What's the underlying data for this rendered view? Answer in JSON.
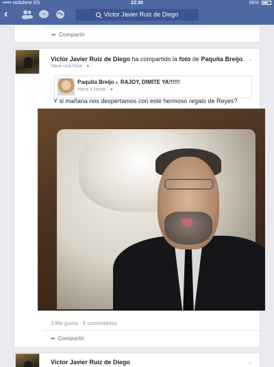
{
  "status_bar": {
    "carrier": "••••• vodafone ES",
    "time": "22:30",
    "battery": "66%",
    "battery_level": 0.66
  },
  "nav": {
    "search_text": "Victor Javier Ruiz de Diego"
  },
  "top_card": {
    "share_label": "Compartir"
  },
  "post": {
    "author": "Victor Javier Ruiz de Diego",
    "action": " ha compartido la ",
    "object": "foto",
    "prep": " de ",
    "target": "Paquita Breijo",
    "end": ".",
    "time": "Hace una hora",
    "privacy_sep": "·",
    "shared": {
      "author": "Paquita Breijo",
      "arrow": "▶",
      "group": "RAJOY, DIMITE YA!!!!!!",
      "time": "Hace 4 horas",
      "privacy_sep": "·"
    },
    "caption": "Y si mañana nos despertamos con este hermoso regalo de Reyes?",
    "likes": "3 Me gusta",
    "dot": "·",
    "comments": "8 comentarios",
    "share_label": "Compartir"
  },
  "next_post": {
    "author": "Victor Javier Ruiz de Diego"
  }
}
